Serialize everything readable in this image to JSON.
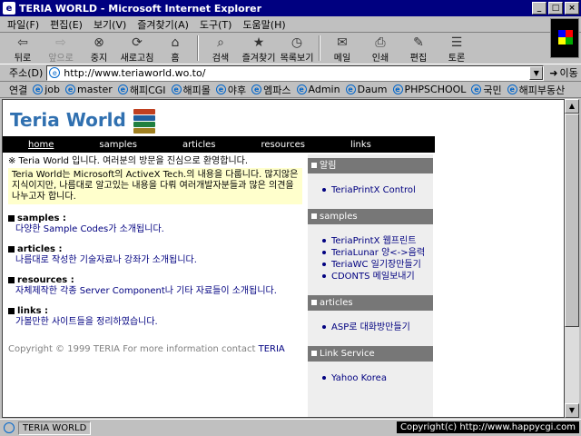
{
  "window": {
    "title": "TERIA WORLD - Microsoft Internet Explorer",
    "minimize": "_",
    "maximize": "□",
    "close": "×"
  },
  "menu": [
    "파일(F)",
    "편집(E)",
    "보기(V)",
    "즐겨찾기(A)",
    "도구(T)",
    "도움말(H)"
  ],
  "toolbar": {
    "back": "뒤로",
    "forward": "앞으로",
    "stop": "중지",
    "refresh": "새로고침",
    "home": "홈",
    "search": "검색",
    "favorites": "즐겨찾기",
    "history": "목록보기",
    "mail": "메일",
    "print": "인쇄",
    "edit": "편집",
    "discuss": "토론"
  },
  "address": {
    "label": "주소(D)",
    "url": "http://www.teriaworld.wo.to/",
    "go": "이동"
  },
  "links": {
    "label": "연결",
    "items": [
      "job",
      "master",
      "해피CGI",
      "해피몰",
      "야후",
      "엠파스",
      "Admin",
      "Daum",
      "PHPSCHOOL",
      "국민",
      "해피부동산"
    ]
  },
  "page": {
    "logo": "Teria World",
    "nav": [
      "home",
      "samples",
      "articles",
      "resources",
      "links"
    ],
    "intro_line": "※ Teria World 입니다. 여러분의 방문을 진심으로 환영합니다.",
    "intro_box": "Teria World는 Microsoft의 ActiveX Tech.의 내용을 다룹니다. 많지않은 지식이지만, 나름대로 알고있는 내용을 다뤄 여러개발자분들과 많은 의견을 나누고자 합니다.",
    "sections": [
      {
        "title": "samples :",
        "desc": "다양한 Sample Codes가 소개됩니다."
      },
      {
        "title": "articles :",
        "desc": "나름대로 작성한 기술자료나 강좌가 소개됩니다."
      },
      {
        "title": "resources :",
        "desc": "자체제작한 각종 Server Component나 기타 자료들이 소개됩니다."
      },
      {
        "title": "links :",
        "desc": "가볼만한 사이트들을 정리하였습니다."
      }
    ],
    "copyright_prefix": "Copyright © 1999 TERIA For more information contact",
    "copyright_link": "TERIA",
    "sidebar": [
      {
        "title": "알림",
        "items": [
          "TeriaPrintX Control"
        ]
      },
      {
        "title": "samples",
        "items": [
          "TeriaPrintX 웹프린트",
          "TeriaLunar 양<->음력",
          "TeriaWC 일기장만들기",
          "CDONTS 메일보내기"
        ]
      },
      {
        "title": "articles",
        "items": [
          "ASP로 대화방만들기"
        ]
      },
      {
        "title": "Link Service",
        "items": [
          "Yahoo Korea"
        ]
      }
    ]
  },
  "status": {
    "text": "TERIA WORLD",
    "watermark": "Copyright(c) http://www.happycgi.com"
  }
}
